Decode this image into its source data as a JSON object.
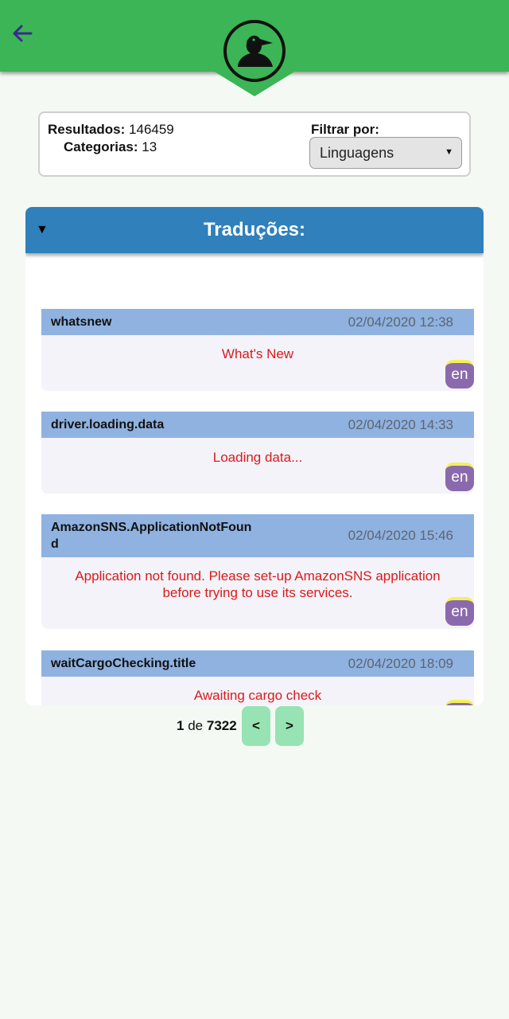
{
  "header": {
    "back_icon": "arrow-left-icon",
    "logo_icon": "pelican-icon",
    "accent": "#3bb556"
  },
  "info": {
    "results_label": "Resultados:",
    "results_value": "146459",
    "categories_label": "Categorias:",
    "categories_value": "13",
    "filter_label": "Filtrar por:",
    "filter_selected": "Linguagens"
  },
  "panel": {
    "title": "Traduções:",
    "toggle_icon": "caret-down-icon"
  },
  "entries": [
    {
      "key": "whatsnew",
      "date": "02/04/2020 12:38",
      "value": "What's New",
      "lang": "en"
    },
    {
      "key": "driver.loading.data",
      "date": "02/04/2020 14:33",
      "value": "Loading data...",
      "lang": "en"
    },
    {
      "key": "AmazonSNS.ApplicationNotFound",
      "date": "02/04/2020 15:46",
      "value": "Application not found. Please set-up AmazonSNS application before trying to use its services.",
      "lang": "en"
    },
    {
      "key": "waitCargoChecking.title",
      "date": "02/04/2020 18:09",
      "value": "Awaiting cargo check",
      "lang": "en"
    }
  ],
  "pager": {
    "current": "1",
    "of_label": "de",
    "total": "7322",
    "prev_label": "<",
    "next_label": ">"
  }
}
